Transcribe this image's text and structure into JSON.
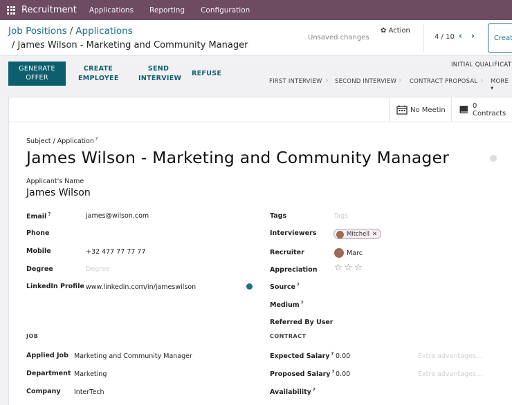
{
  "navbar": {
    "app_name": "Recruitment",
    "menu": [
      "Applications",
      "Reporting",
      "Configuration"
    ]
  },
  "breadcrumb": {
    "parent1": "Job Positions",
    "parent2": "Applications",
    "current": "/ James Wilson - Marketing and Community Manager"
  },
  "control": {
    "unsaved": "Unsaved changes",
    "action": "Action",
    "pager": "4 / 10",
    "create": "Creat"
  },
  "statusbar": {
    "generate_offer_line1": "GENERATE",
    "generate_offer_line2": "OFFER",
    "create_employee_line1": "CREATE",
    "create_employee_line2": "EMPLOYEE",
    "send_interview_line1": "SEND",
    "send_interview_line2": "INTERVIEW",
    "refuse": "REFUSE",
    "stage_top": "INITIAL QUALIFICATIO",
    "stages": [
      "FIRST INTERVIEW",
      "SECOND INTERVIEW",
      "CONTRACT PROPOSAL",
      "MORE"
    ]
  },
  "smart_buttons": {
    "meetings": "No Meetin",
    "contracts_count": "0",
    "contracts_label": "Contracts"
  },
  "form": {
    "subject_label": "Subject / Application",
    "subject": "James Wilson - Marketing and Community Manager",
    "applicant_label": "Applicant's Name",
    "applicant": "James Wilson",
    "email_label": "Email",
    "email": "james@wilson.com",
    "phone_label": "Phone",
    "mobile_label": "Mobile",
    "mobile": "+32 477 77 77 77",
    "degree_label": "Degree",
    "degree_placeholder": "Degree",
    "linkedin_label": "LinkedIn Profile",
    "linkedin": "www.linkedin.com/in/jameswilson",
    "tags_label": "Tags",
    "tags_placeholder": "Tags",
    "interviewers_label": "Interviewers",
    "interviewer_tag": "Mitchell",
    "recruiter_label": "Recruiter",
    "recruiter": "Marc",
    "appreciation_label": "Appreciation",
    "appreciation_stars": "☆☆☆",
    "source_label": "Source",
    "medium_label": "Medium",
    "referred_label": "Referred By User",
    "job_section": "JOB",
    "applied_job_label": "Applied Job",
    "applied_job": "Marketing and Community Manager",
    "department_label": "Department",
    "department": "Marketing",
    "company_label": "Company",
    "company": "InterTech",
    "contract_section": "CONTRACT",
    "expected_salary_label": "Expected Salary",
    "expected_salary": "0.00",
    "proposed_salary_label": "Proposed Salary",
    "proposed_salary": "0.00",
    "extra_placeholder": "Extra advantages...",
    "availability_label": "Availability"
  }
}
